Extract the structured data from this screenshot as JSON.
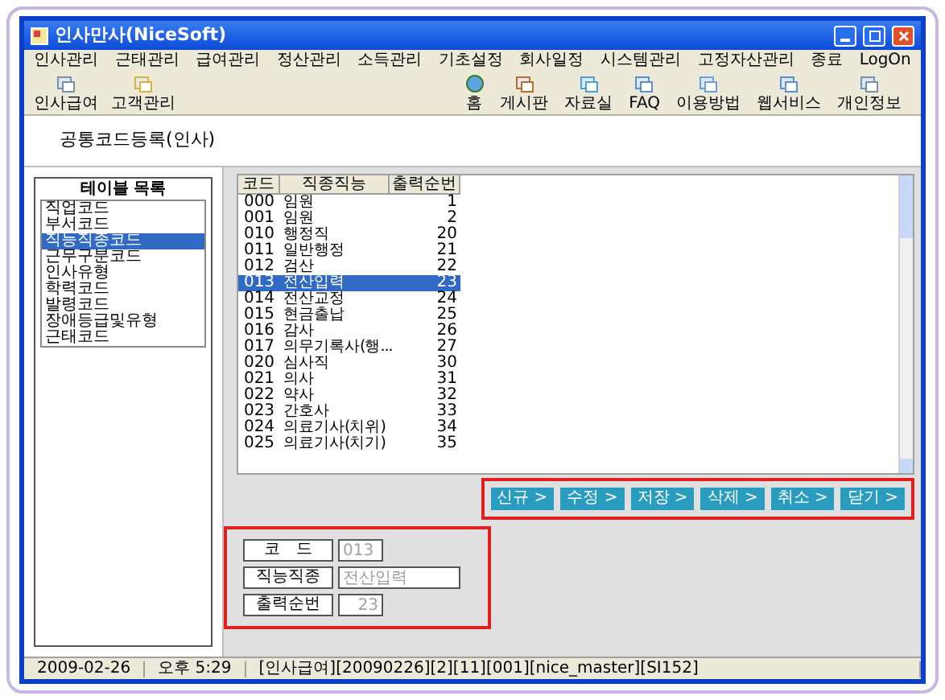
{
  "window": {
    "title": "인사만사(NiceSoft)"
  },
  "menu": [
    "인사관리",
    "근태관리",
    "급여관리",
    "정산관리",
    "소득관리",
    "기초설정",
    "회사일정",
    "시스템관리",
    "고정자산관리",
    "종료",
    "LogOn"
  ],
  "toolbar_left": [
    "인사급여",
    "고객관리"
  ],
  "toolbar_right": [
    "홈",
    "게시판",
    "자료실",
    "FAQ",
    "이용방법",
    "웹서비스",
    "개인정보"
  ],
  "page_title": "공통코드등록(인사)",
  "table_list": {
    "title": "테이블 목록",
    "items": [
      {
        "label": "직업코드",
        "selected": false
      },
      {
        "label": "부서코드",
        "selected": false
      },
      {
        "label": "직능직종코드",
        "selected": true
      },
      {
        "label": "근무구분코드",
        "selected": false
      },
      {
        "label": "인사유형",
        "selected": false
      },
      {
        "label": "학력코드",
        "selected": false
      },
      {
        "label": "발령코드",
        "selected": false
      },
      {
        "label": "장애등급및유형",
        "selected": false
      },
      {
        "label": "근태코드",
        "selected": false
      }
    ]
  },
  "grid": {
    "columns": [
      "코드",
      "직종직능",
      "출력순번"
    ],
    "rows": [
      {
        "cells": [
          "000",
          "임원",
          "1"
        ],
        "selected": false
      },
      {
        "cells": [
          "001",
          "임원",
          "2"
        ],
        "selected": false
      },
      {
        "cells": [
          "010",
          "행정직",
          "20"
        ],
        "selected": false
      },
      {
        "cells": [
          "011",
          "일반행정",
          "21"
        ],
        "selected": false
      },
      {
        "cells": [
          "012",
          "검산",
          "22"
        ],
        "selected": false
      },
      {
        "cells": [
          "013",
          "전산입력",
          "23"
        ],
        "selected": true
      },
      {
        "cells": [
          "014",
          "전산교정",
          "24"
        ],
        "selected": false
      },
      {
        "cells": [
          "015",
          "현금출납",
          "25"
        ],
        "selected": false
      },
      {
        "cells": [
          "016",
          "감사",
          "26"
        ],
        "selected": false
      },
      {
        "cells": [
          "017",
          "의무기록사(행...",
          "27"
        ],
        "selected": false
      },
      {
        "cells": [
          "020",
          "심사직",
          "30"
        ],
        "selected": false
      },
      {
        "cells": [
          "021",
          "의사",
          "31"
        ],
        "selected": false
      },
      {
        "cells": [
          "022",
          "약사",
          "32"
        ],
        "selected": false
      },
      {
        "cells": [
          "023",
          "간호사",
          "33"
        ],
        "selected": false
      },
      {
        "cells": [
          "024",
          "의료기사(치위)",
          "34"
        ],
        "selected": false
      },
      {
        "cells": [
          "025",
          "의료기사(치기)",
          "35"
        ],
        "selected": false
      }
    ]
  },
  "buttons": [
    "신규 >",
    "수정 >",
    "저장 >",
    "삭제 >",
    "취소 >",
    "닫기 >"
  ],
  "form": [
    {
      "label": "코　드",
      "value": "013",
      "disabled": true
    },
    {
      "label": "직능직종",
      "value": "전산입력",
      "disabled": true
    },
    {
      "label": "출력순번",
      "value": "23",
      "disabled": true
    }
  ],
  "status_bar": [
    "2009-02-26",
    "오후 5:29",
    "[인사급여][20090226][2][11][001][nice_master][SI152]"
  ]
}
